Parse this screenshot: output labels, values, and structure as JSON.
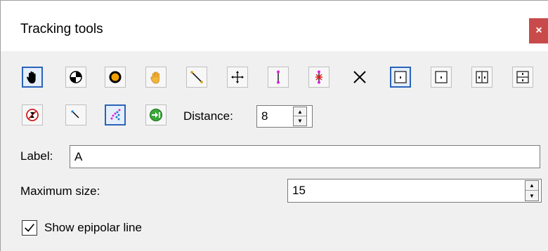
{
  "window": {
    "title": "Tracking tools",
    "close_label": "×"
  },
  "toolbar_row1": [
    {
      "name": "hand-tool-button",
      "icon": "hand-icon",
      "selected": true
    },
    {
      "name": "target-tool-button",
      "icon": "quadrant-target-icon",
      "selected": false
    },
    {
      "name": "ring-tool-button",
      "icon": "ring-icon",
      "selected": false
    },
    {
      "name": "grab-tool-button",
      "icon": "grab-hand-icon",
      "selected": false
    },
    {
      "name": "line-tool-button",
      "icon": "diagonal-line-icon",
      "selected": false
    },
    {
      "name": "move-tool-button",
      "icon": "move-cross-icon",
      "selected": false
    },
    {
      "name": "vertical-segment-button",
      "icon": "vertical-segment-icon",
      "selected": false
    },
    {
      "name": "vertical-star-button",
      "icon": "vertical-star-icon",
      "selected": false
    },
    {
      "name": "x-cross-button",
      "icon": "x-cross-icon",
      "selected": false
    },
    {
      "name": "layout-1-button",
      "icon": "layout-single-icon",
      "selected": true
    },
    {
      "name": "layout-2-button",
      "icon": "layout-dot-icon",
      "selected": false
    },
    {
      "name": "layout-split-h-button",
      "icon": "layout-split-horizontal-icon",
      "selected": false
    },
    {
      "name": "layout-split-v-button",
      "icon": "layout-split-vertical-icon",
      "selected": false
    }
  ],
  "toolbar_row2": [
    {
      "name": "delete-track-button",
      "icon": "delete-track-icon",
      "selected": false
    },
    {
      "name": "short-line-button",
      "icon": "short-line-icon",
      "selected": false
    },
    {
      "name": "scatter-track-button",
      "icon": "scatter-track-icon",
      "selected": true
    },
    {
      "name": "go-to-button",
      "icon": "arrow-to-icon",
      "selected": false
    }
  ],
  "distance": {
    "label": "Distance:",
    "value": "8"
  },
  "label_field": {
    "label": "Label:",
    "value": "A"
  },
  "max_size": {
    "label": "Maximum size:",
    "value": "15"
  },
  "epipolar": {
    "label": "Show epipolar line",
    "checked": true
  },
  "colors": {
    "selected_border": "#2a63b8",
    "close_red": "#c94a4a",
    "magenta": "#e020e0",
    "accent_yellow": "#d8a000"
  }
}
